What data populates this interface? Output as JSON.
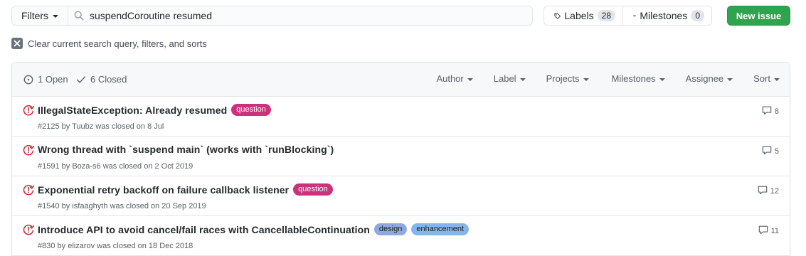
{
  "toolbar": {
    "filters_label": "Filters",
    "search_value": "suspendCoroutine resumed",
    "labels_label": "Labels",
    "labels_count": "28",
    "milestones_label": "Milestones",
    "milestones_count": "0",
    "new_issue_label": "New issue"
  },
  "clear_query_label": "Clear current search query, filters, and sorts",
  "header": {
    "open_label": "1 Open",
    "closed_label": "6 Closed",
    "menus": [
      "Author",
      "Label",
      "Projects",
      "Milestones",
      "Assignee",
      "Sort"
    ]
  },
  "colors": {
    "closed_icon": "#cb2431",
    "primary_button": "#2ea44f",
    "label_question": "#cc317c",
    "label_design": "#8fa8e0",
    "label_enhancement": "#84b6eb"
  },
  "issues": [
    {
      "title": "IllegalStateException: Already resumed",
      "labels": [
        {
          "name": "question",
          "bg": "#cc317c",
          "fg": "#ffffff"
        }
      ],
      "meta": "#2125 by Tuubz was closed on 8 Jul",
      "comments": "8"
    },
    {
      "title": "Wrong thread with `suspend main` (works with `runBlocking`)",
      "labels": [],
      "meta": "#1591 by Boza-s6 was closed on 2 Oct 2019",
      "comments": "5"
    },
    {
      "title": "Exponential retry backoff on failure callback listener",
      "labels": [
        {
          "name": "question",
          "bg": "#cc317c",
          "fg": "#ffffff"
        }
      ],
      "meta": "#1540 by isfaaghyth was closed on 20 Sep 2019",
      "comments": "12"
    },
    {
      "title": "Introduce API to avoid cancel/fail races with CancellableContinuation",
      "labels": [
        {
          "name": "design",
          "bg": "#8fa8e0",
          "fg": "#1b1f23"
        },
        {
          "name": "enhancement",
          "bg": "#84b6eb",
          "fg": "#1b1f23"
        }
      ],
      "meta": "#830 by elizarov was closed on 18 Dec 2018",
      "comments": "11"
    }
  ]
}
